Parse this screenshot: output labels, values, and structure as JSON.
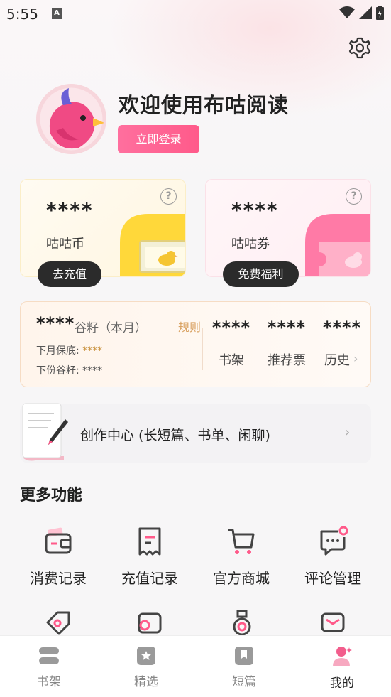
{
  "status_bar": {
    "time": "5:55",
    "a_icon": "A"
  },
  "header": {
    "welcome": "欢迎使用布咕阅读",
    "login_label": "立即登录"
  },
  "cards": {
    "coin": {
      "value": "****",
      "label": "咕咕币",
      "action": "去充值"
    },
    "coupon": {
      "value": "****",
      "label": "咕咕券",
      "action": "免费福利"
    }
  },
  "stats": {
    "grain_value": "****",
    "grain_label": "谷籽（本月）",
    "rules": "规则",
    "guarantee_label": "下月保底:",
    "guarantee_value": "****",
    "next_label": "下份谷籽:",
    "next_value": "****",
    "items": [
      {
        "value": "****",
        "label": "书架"
      },
      {
        "value": "****",
        "label": "推荐票"
      },
      {
        "value": "****",
        "label": "历史"
      }
    ]
  },
  "creation": {
    "label": "创作中心 (长短篇、书单、闲聊)"
  },
  "more": {
    "title": "更多功能",
    "features": [
      {
        "label": "消费记录",
        "icon": "wallet-icon"
      },
      {
        "label": "充值记录",
        "icon": "receipt-icon"
      },
      {
        "label": "官方商城",
        "icon": "cart-icon"
      },
      {
        "label": "评论管理",
        "icon": "comment-icon"
      }
    ]
  },
  "tabs": [
    {
      "label": "书架",
      "icon": "bookshelf-icon"
    },
    {
      "label": "精选",
      "icon": "featured-icon"
    },
    {
      "label": "短篇",
      "icon": "short-story-icon"
    },
    {
      "label": "我的",
      "icon": "profile-icon"
    }
  ],
  "colors": {
    "accent": "#ff5a8a",
    "dark_button": "#2b2b2b",
    "gold": "#d9a262"
  }
}
